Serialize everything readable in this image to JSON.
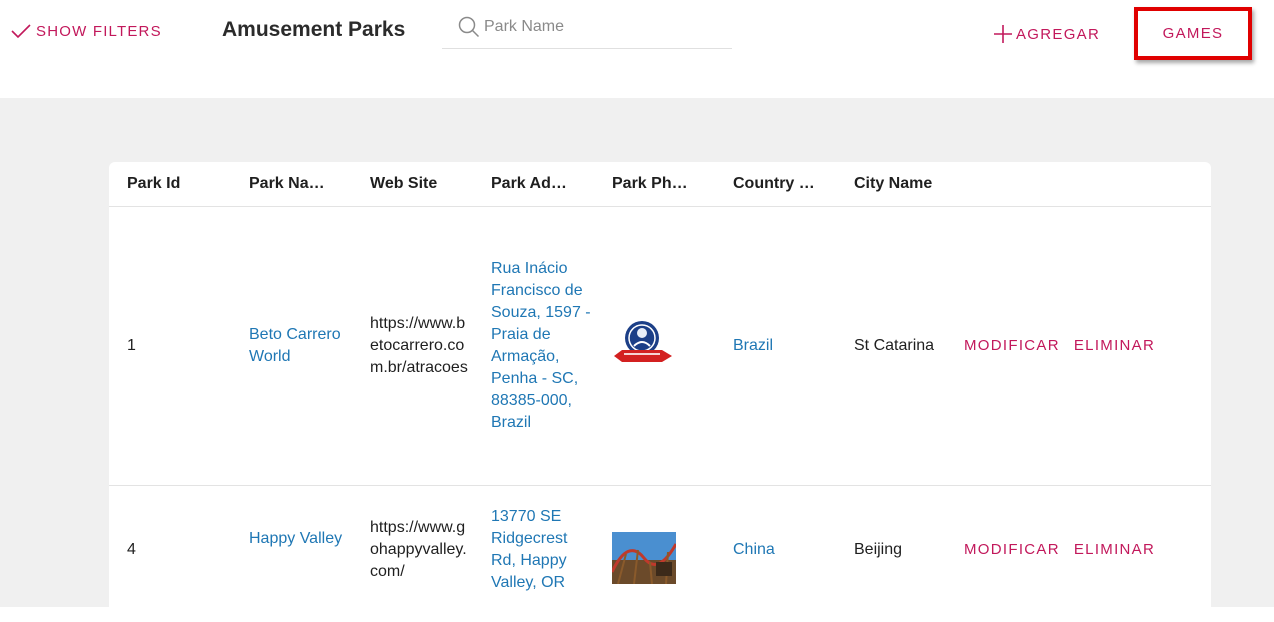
{
  "header": {
    "show_filters_label": "SHOW FILTERS",
    "title": "Amusement Parks",
    "search_placeholder": "Park Name",
    "search_value": "",
    "add_label": "AGREGAR",
    "games_label": "GAMES"
  },
  "table": {
    "columns": [
      "Park Id",
      "Park Na…",
      "Web Site",
      "Park Ad…",
      "Park Ph…",
      "Country …",
      "City Name"
    ],
    "rows": [
      {
        "park_id": "1",
        "park_name": "Beto Carrero World",
        "web_site": "https://www.betocarrero.com.br/atracoes",
        "park_address": "Rua Inácio Francisco de Souza, 1597 - Praia de Armação, Penha - SC, 88385-000, Brazil",
        "park_photo_icon": "beto-carrero-logo",
        "country_name": "Brazil",
        "city_name": "St Catarina",
        "modify_label": "MODIFICAR",
        "delete_label": "ELIMINAR"
      },
      {
        "park_id": "4",
        "park_name": "Happy Valley",
        "web_site": "https://www.gohappyvalley.com/",
        "park_address": "13770 SE Ridgecrest Rd, Happy Valley, OR",
        "park_photo_icon": "roller-coaster-photo",
        "country_name": "China",
        "city_name": "Beijing",
        "modify_label": "MODIFICAR",
        "delete_label": "ELIMINAR"
      }
    ]
  },
  "colors": {
    "accent": "#c2185b",
    "link": "#1f77b4",
    "highlight_border": "#e00000",
    "content_bg": "#f0f0f0"
  }
}
